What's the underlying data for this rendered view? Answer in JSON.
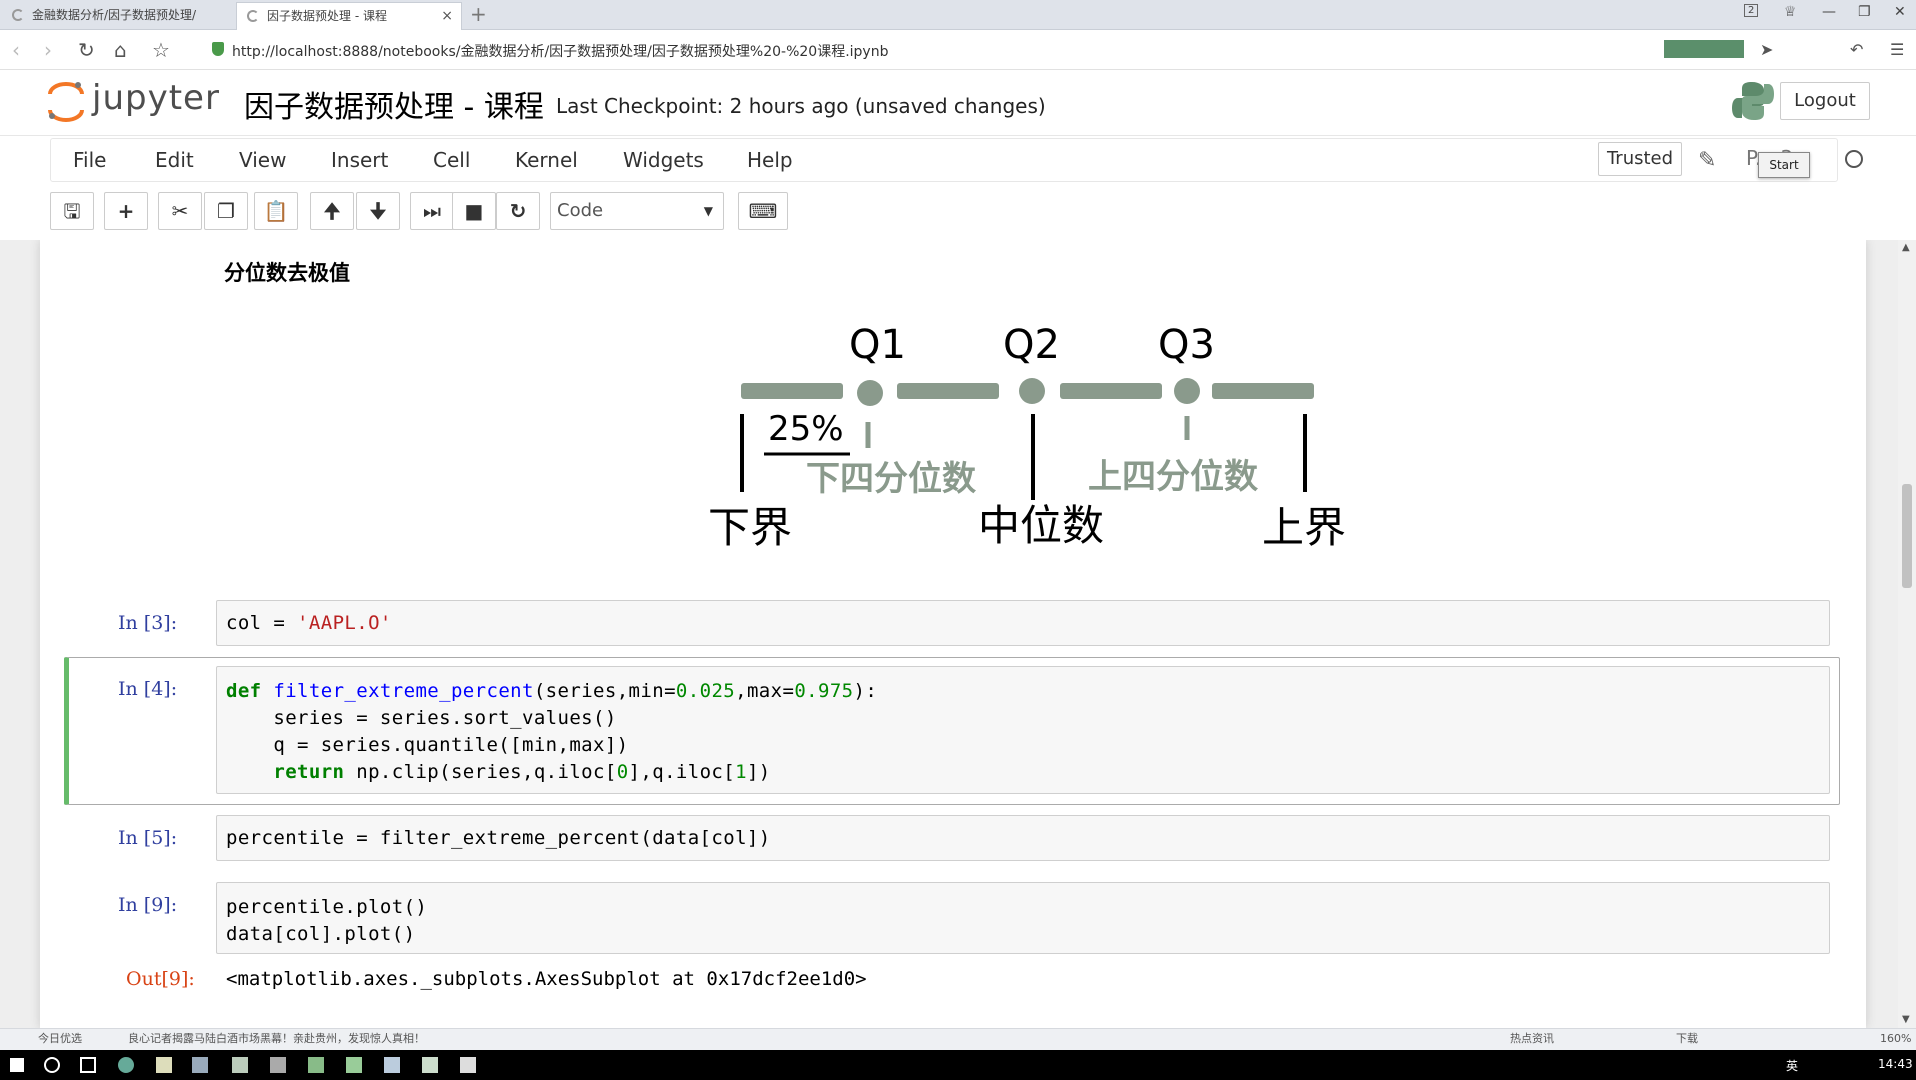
{
  "browser": {
    "tabs": [
      {
        "label": "金融数据分析/因子数据预处理/"
      },
      {
        "label": "因子数据预处理 - 课程"
      }
    ],
    "new_tab": "+",
    "url": "http://localhost:8888/notebooks/金融数据分析/因子数据预处理/因子数据预处理%20-%20课程.ipynb",
    "tab_close": "×",
    "window_badge": "2"
  },
  "header": {
    "logo_text": "jupyter",
    "notebook_title": "因子数据预处理 - 课程",
    "checkpoint": "Last Checkpoint: 2 hours ago (unsaved changes)",
    "logout_label": "Logout"
  },
  "menu": {
    "items": [
      "File",
      "Edit",
      "View",
      "Insert",
      "Cell",
      "Kernel",
      "Widgets",
      "Help"
    ],
    "trusted_label": "Trusted",
    "kernel_name": "P... 3",
    "start_label": "Start"
  },
  "toolbar": {
    "cell_type": "Code"
  },
  "notebook": {
    "markdown_heading": "分位数去极值",
    "diagram": {
      "q1": "Q1",
      "q2": "Q2",
      "q3": "Q3",
      "pct": "25%",
      "lower_quartile": "下四分位数",
      "upper_quartile": "上四分位数",
      "lower_bound": "下界",
      "median": "中位数",
      "upper_bound": "上界"
    },
    "cells": [
      {
        "prompt": "In  [3]:"
      },
      {
        "prompt": "In  [4]:"
      },
      {
        "prompt": "In  [5]:"
      },
      {
        "prompt": "In  [9]:"
      }
    ],
    "out_prompt": "Out[9]:",
    "output_text": "<matplotlib.axes._subplots.AxesSubplot at 0x17dcf2ee1d0>"
  },
  "statusbar": {
    "left": "今日优选",
    "news": "良心记者揭露马陆白酒市场黑幕！亲赴贵州，发现惊人真相！",
    "hot": "热点资讯",
    "download": "下载",
    "zoom": "160%"
  },
  "taskbar": {
    "lang": "英",
    "time": "14:43"
  },
  "colors": {
    "green_accent": "#66bb6a",
    "prompt_in": "#303f9f",
    "prompt_out": "#d84315",
    "diagram_gray": "#8a9a8c"
  }
}
